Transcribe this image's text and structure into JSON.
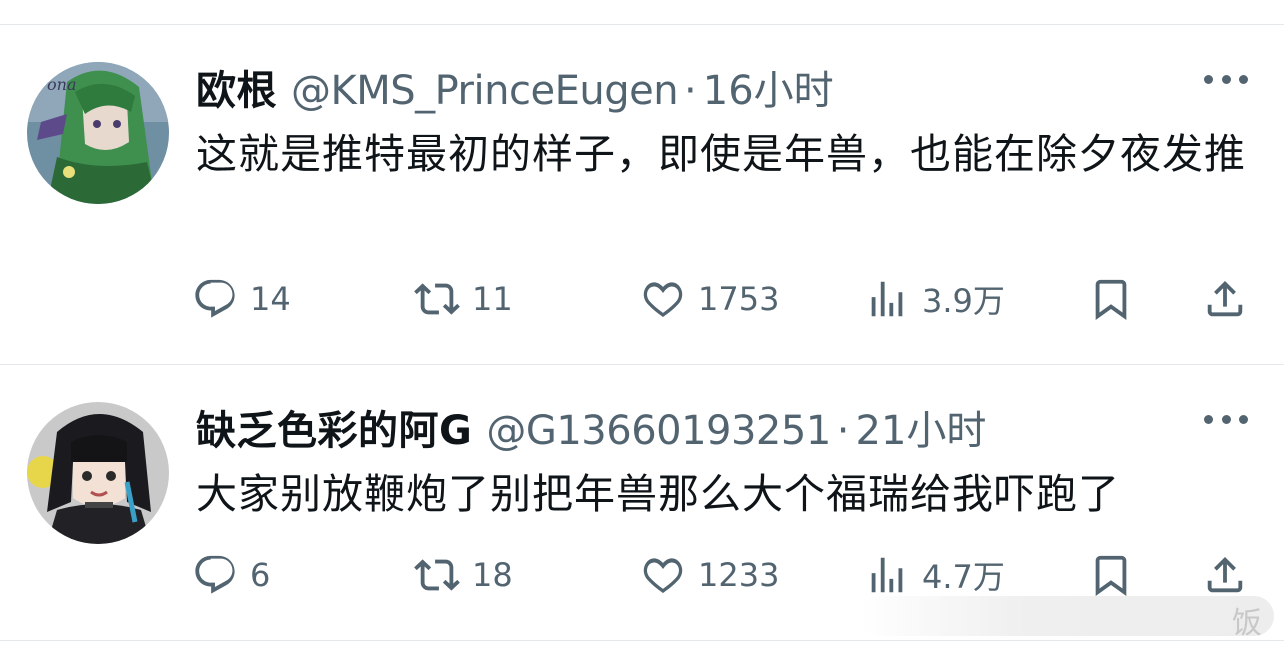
{
  "tweets": [
    {
      "name": "欧根",
      "handle": "@KMS_PrinceEugen",
      "separator": "·",
      "time": "16小时",
      "text": "这就是推特最初的样子，即使是年兽，也能在除夕夜发推",
      "avatar_text": "ona",
      "stats": {
        "replies": "14",
        "retweets": "11",
        "likes": "1753",
        "views": "3.9万"
      }
    },
    {
      "name": "缺乏色彩的阿G",
      "handle": "@G13660193251",
      "separator": "·",
      "time": "21小时",
      "text": "大家别放鞭炮了别把年兽那么大个福瑞给我吓跑了",
      "stats": {
        "replies": "6",
        "retweets": "18",
        "likes": "1233",
        "views": "4.7万"
      }
    }
  ],
  "watermark": {
    "text": "饭"
  },
  "colors": {
    "text": "#0f1419",
    "secondary": "#536471",
    "divider": "#e6e9ec"
  }
}
